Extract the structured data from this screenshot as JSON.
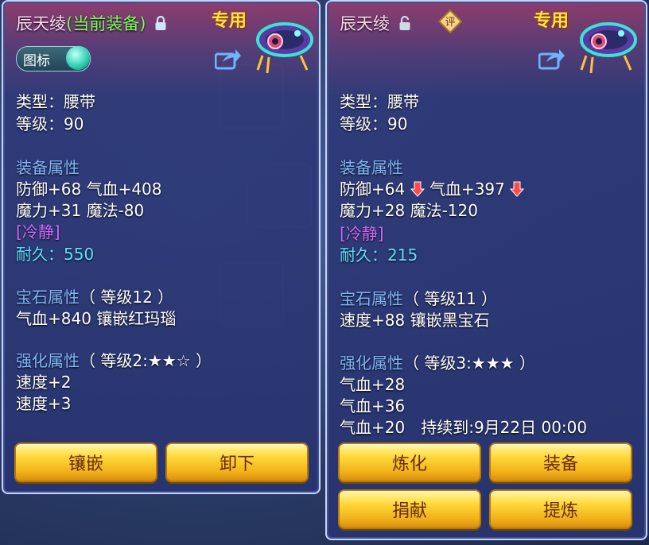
{
  "left": {
    "name": "辰天绫",
    "equipped_tag": "(当前装备)",
    "special_tag": "专用",
    "badge_label": "图标",
    "type": "类型：腰带",
    "level": "等级：90",
    "equip_header": "装备属性",
    "attr_line1": "防御+68 气血+408",
    "attr_line2": "魔力+31 魔法-80",
    "special_effect": "[冷静]",
    "durability": "耐久：550",
    "gem_header": "宝石属性",
    "gem_level": "（ 等级12 ）",
    "gem_line": "气血+840 镶嵌红玛瑙",
    "enhance_header": "强化属性",
    "enhance_level": "（ 等级2:★★☆ ）",
    "enhance_line1": "速度+2",
    "enhance_line2": "速度+3",
    "buttons": [
      "镶嵌",
      "卸下"
    ]
  },
  "right": {
    "name": "辰天绫",
    "rate_label": "评",
    "special_tag": "专用",
    "type": "类型：腰带",
    "level": "等级：90",
    "equip_header": "装备属性",
    "attr_def": "防御+64",
    "attr_hp": "气血+397",
    "attr_line2": "魔力+28 魔法-120",
    "special_effect": "[冷静]",
    "durability": "耐久：215",
    "gem_header": "宝石属性",
    "gem_level": "（ 等级11 ）",
    "gem_line": "速度+88 镶嵌黑宝石",
    "enhance_header": "强化属性",
    "enhance_level": "（ 等级3:★★★ ）",
    "enhance_line1": "气血+28",
    "enhance_line2": "气血+36",
    "enhance_line3": "气血+20　持续到:9月22日 00:00",
    "buttons": [
      "炼化",
      "装备",
      "捐献",
      "提炼"
    ]
  }
}
